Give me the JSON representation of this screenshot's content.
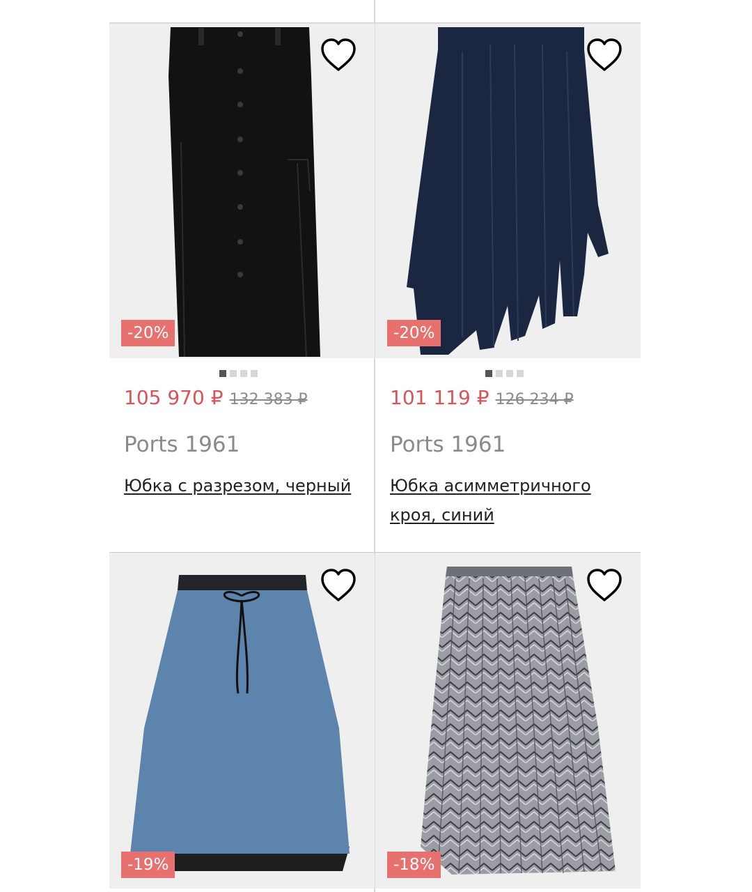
{
  "products": [
    {
      "discount": "-20%",
      "price_current": "105 970 ₽",
      "price_old": "132 383 ₽",
      "brand": "Ports 1961",
      "title": "Юбка с разрезом, черный",
      "garment_color": "#121212",
      "image_dots": 4,
      "active_dot": 0
    },
    {
      "discount": "-20%",
      "price_current": "101 119 ₽",
      "price_old": "126 234 ₽",
      "brand": "Ports 1961",
      "title": "Юбка асимметричного кроя, синий",
      "garment_color": "#1b2740",
      "image_dots": 4,
      "active_dot": 0
    },
    {
      "discount": "-19%",
      "garment_color": "#5d84ad"
    },
    {
      "discount": "-18%",
      "garment_color": "#8a8d92"
    }
  ],
  "colors": {
    "price": "#d9545a",
    "badge": "#e7716f",
    "divider": "#d9d9d9",
    "image_bg": "#efefef"
  },
  "icons": {
    "favorite": "heart-outline-icon"
  }
}
